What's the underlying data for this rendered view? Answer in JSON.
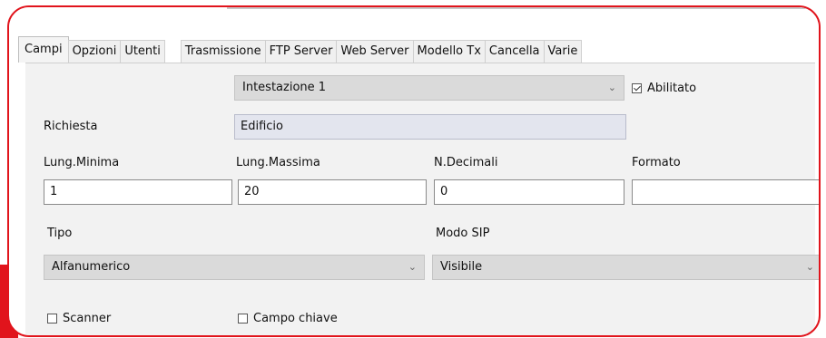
{
  "tabs": [
    "Campi",
    "Opzioni",
    "Utenti",
    "Trasmissione",
    "FTP Server",
    "Web Server",
    "Modello Tx",
    "Cancella",
    "Varie"
  ],
  "header_select": {
    "value": "Intestazione 1"
  },
  "enabled": {
    "label": "Abilitato",
    "checked": true
  },
  "richiesta": {
    "label": "Richiesta",
    "value": "Edificio"
  },
  "fields": {
    "min_label": "Lung.Minima",
    "min_value": "1",
    "max_label": "Lung.Massima",
    "max_value": "20",
    "dec_label": "N.Decimali",
    "dec_value": "0",
    "fmt_label": "Formato",
    "fmt_value": ""
  },
  "tipo": {
    "label": "Tipo",
    "value": "Alfanumerico"
  },
  "modo_sip": {
    "label": "Modo SIP",
    "value": "Visibile"
  },
  "checks": {
    "scanner": {
      "label": "Scanner",
      "checked": false
    },
    "campo_chiave": {
      "label": "Campo chiave",
      "checked": false
    }
  },
  "colors": {
    "frame": "#e1141c",
    "panel": "#f2f2f2"
  }
}
